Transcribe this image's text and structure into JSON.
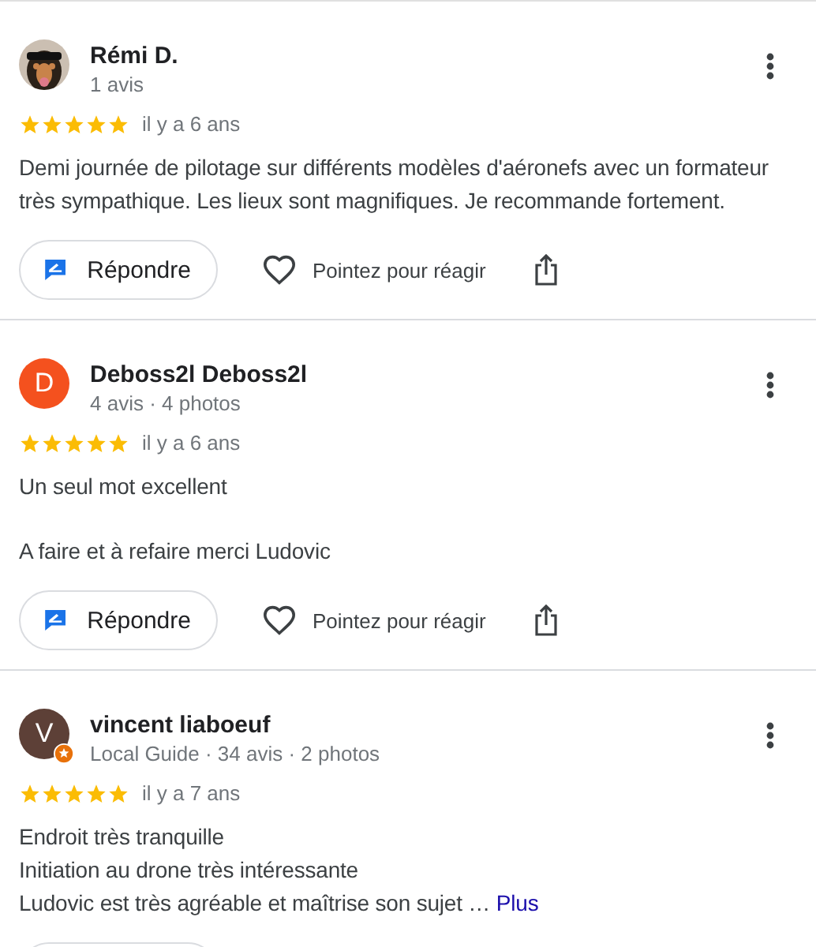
{
  "reviews": [
    {
      "name": "Rémi D.",
      "meta": "1 avis",
      "avatar": {
        "kind": "picture"
      },
      "stars": 5,
      "time": "il y a 6 ans",
      "paragraphs": [
        [
          "Demi journée de pilotage sur différents modèles d'aéronefs avec un formateur très sympathique. Les lieux sont magnifiques. Je recommande fortement."
        ]
      ],
      "reply_label": "Répondre",
      "react_label": "Pointez pour réagir",
      "actions_shown": true
    },
    {
      "name": "Deboss2l Deboss2l",
      "meta": "4 avis · 4 photos",
      "avatar": {
        "kind": "letter",
        "letter": "D",
        "color": "#f4511e",
        "local_guide": false
      },
      "stars": 5,
      "time": "il y a 6 ans",
      "paragraphs": [
        [
          "Un seul mot excellent"
        ],
        [
          "A faire et à refaire merci Ludovic"
        ]
      ],
      "reply_label": "Répondre",
      "react_label": "Pointez pour réagir",
      "actions_shown": true
    },
    {
      "name": "vincent liaboeuf",
      "meta": "Local Guide · 34 avis · 2 photos",
      "avatar": {
        "kind": "letter",
        "letter": "V",
        "color": "#5d4037",
        "local_guide": true
      },
      "stars": 5,
      "time": "il y a 7 ans",
      "paragraphs": [
        [
          "Endroit très tranquille",
          "Initiation au drone très intéressante",
          "Ludovic est très agréable et maîtrise son sujet …"
        ]
      ],
      "more_link": "Plus",
      "actions_shown": false
    }
  ]
}
